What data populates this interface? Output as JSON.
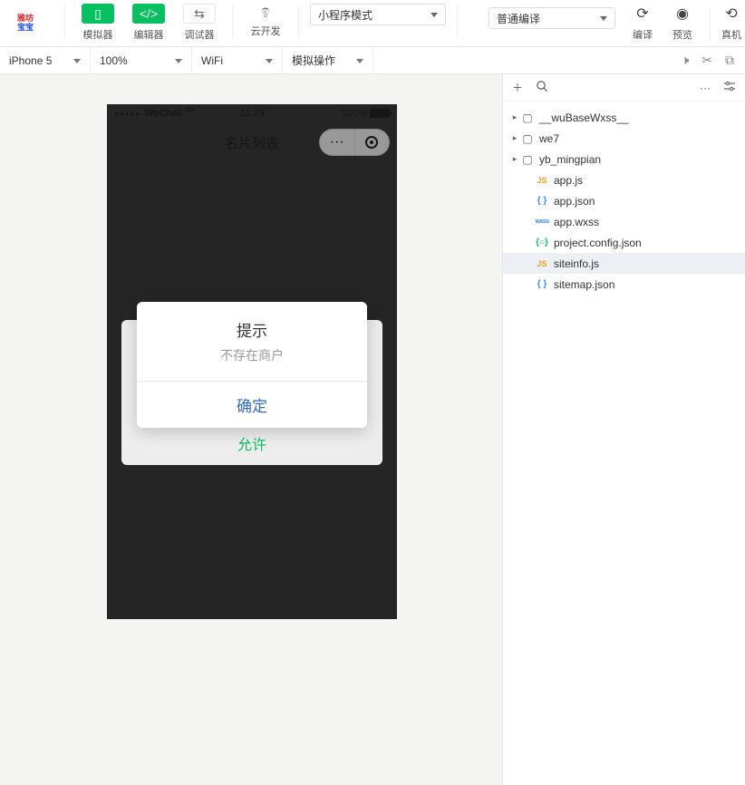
{
  "toolbar": {
    "simulator": "模拟器",
    "editor": "编辑器",
    "debugger": "调试器",
    "cloud": "云开发",
    "mode": "小程序模式",
    "compile_mode": "普通编译",
    "compile": "编译",
    "preview": "预览",
    "remote": "真机"
  },
  "subbar": {
    "device": "iPhone 5",
    "zoom": "100%",
    "network": "WiFi",
    "sim_action": "模拟操作"
  },
  "phone": {
    "carrier": "WeChat",
    "time": "18:29",
    "battery": "100%",
    "nav_title": "名片列表",
    "allow": "允许",
    "modal_title": "提示",
    "modal_msg": "不存在商户",
    "modal_ok": "确定"
  },
  "tree": {
    "folders": [
      {
        "name": "__wuBaseWxss__"
      },
      {
        "name": "we7"
      },
      {
        "name": "yb_mingpian"
      }
    ],
    "files": [
      {
        "name": "app.js",
        "type": "js"
      },
      {
        "name": "app.json",
        "type": "json"
      },
      {
        "name": "app.wxss",
        "type": "wxss"
      },
      {
        "name": "project.config.json",
        "type": "config"
      },
      {
        "name": "siteinfo.js",
        "type": "js",
        "selected": true
      },
      {
        "name": "sitemap.json",
        "type": "json"
      }
    ]
  }
}
